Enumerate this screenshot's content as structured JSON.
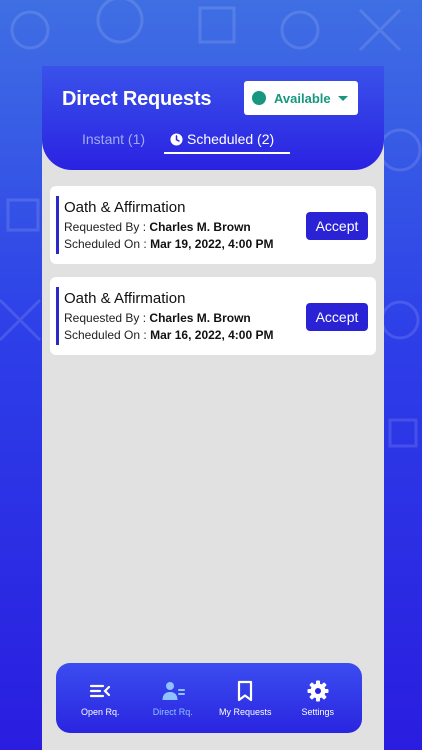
{
  "header": {
    "title": "Direct Requests"
  },
  "status": {
    "label": "Available",
    "color": "#17977f"
  },
  "tabs": [
    {
      "label": "Instant (1)",
      "active": false
    },
    {
      "label": "Scheduled (2)",
      "active": true
    }
  ],
  "requests": [
    {
      "title": "Oath & Affirmation",
      "requested_by_label": "Requested By :",
      "requested_by": "Charles M. Brown",
      "scheduled_on_label": "Scheduled On :",
      "scheduled_on": "Mar 19, 2022, 4:00 PM",
      "action": "Accept"
    },
    {
      "title": "Oath & Affirmation",
      "requested_by_label": "Requested By :",
      "requested_by": "Charles M. Brown",
      "scheduled_on_label": "Scheduled On :",
      "scheduled_on": "Mar 16, 2022, 4:00 PM",
      "action": "Accept"
    }
  ],
  "nav": [
    {
      "label": "Open Rq.",
      "icon": "open-requests-icon",
      "active": false
    },
    {
      "label": "Direct Rq.",
      "icon": "direct-requests-icon",
      "active": true
    },
    {
      "label": "My Requests",
      "icon": "bookmark-icon",
      "active": false
    },
    {
      "label": "Settings",
      "icon": "gear-icon",
      "active": false
    }
  ],
  "colors": {
    "accent": "#2a23d6",
    "background": "#2d3fe8",
    "active_nav": "#8fc3ff"
  }
}
